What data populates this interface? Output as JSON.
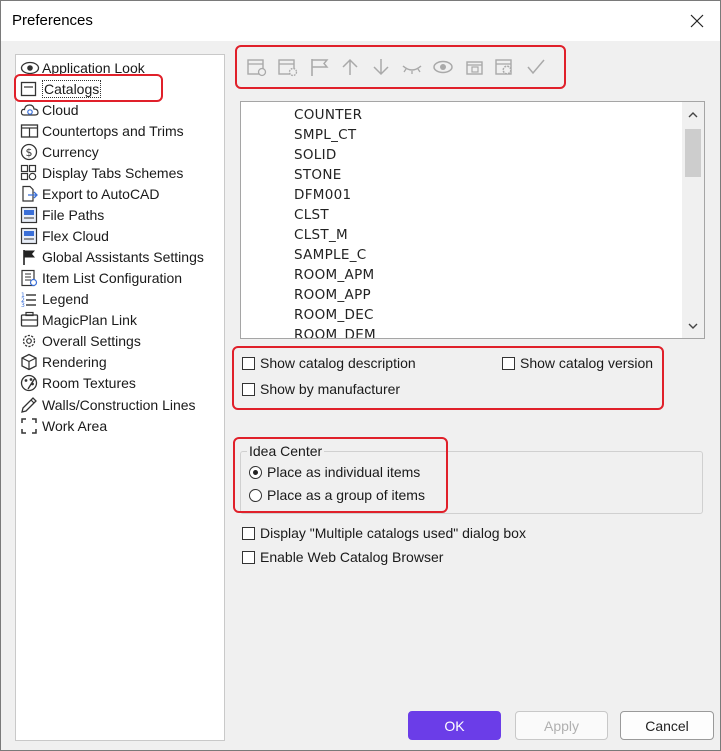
{
  "window": {
    "title": "Preferences"
  },
  "tree": {
    "items": [
      {
        "label": "Application Look",
        "icon": "eye-icon"
      },
      {
        "label": "Catalogs",
        "icon": "catalog-icon",
        "selected": true
      },
      {
        "label": "Cloud",
        "icon": "cloud-icon"
      },
      {
        "label": "Countertops and Trims",
        "icon": "countertop-icon"
      },
      {
        "label": "Currency",
        "icon": "dollar-icon"
      },
      {
        "label": "Display Tabs Schemes",
        "icon": "tabs-scheme-icon"
      },
      {
        "label": "Export to AutoCAD",
        "icon": "export-icon"
      },
      {
        "label": "File Paths",
        "icon": "file-paths-icon"
      },
      {
        "label": "Flex Cloud",
        "icon": "flex-cloud-icon"
      },
      {
        "label": "Global Assistants Settings",
        "icon": "flag-icon"
      },
      {
        "label": "Item List Configuration",
        "icon": "item-list-icon"
      },
      {
        "label": "Legend",
        "icon": "legend-icon"
      },
      {
        "label": "MagicPlan Link",
        "icon": "magicplan-icon"
      },
      {
        "label": "Overall Settings",
        "icon": "gear-icon"
      },
      {
        "label": "Rendering",
        "icon": "cube-icon"
      },
      {
        "label": "Room Textures",
        "icon": "textures-icon"
      },
      {
        "label": "Walls/Construction Lines",
        "icon": "pencil-icon"
      },
      {
        "label": "Work Area",
        "icon": "work-area-icon"
      }
    ]
  },
  "catalog_list": {
    "items": [
      "COUNTER",
      "SMPL_CT",
      "SOLID",
      "STONE",
      "DFM001",
      "CLST",
      "CLST_M",
      "SAMPLE_C",
      "ROOM_APM",
      "ROOM_APP",
      "ROOM_DEC",
      "ROOM_DEM"
    ]
  },
  "options": {
    "show_catalog_description": "Show catalog description",
    "show_catalog_version": "Show catalog version",
    "show_by_manufacturer": "Show by manufacturer",
    "display_multiple_catalogs": "Display \"Multiple catalogs used\" dialog box",
    "enable_web_catalog_browser": "Enable Web Catalog Browser"
  },
  "idea_center": {
    "legend": "Idea Center",
    "place_individual": "Place as individual items",
    "place_group": "Place as a group of items",
    "selected": "place_individual"
  },
  "buttons": {
    "ok": "OK",
    "apply": "Apply",
    "cancel": "Cancel"
  },
  "colors": {
    "accent": "#6b3de8",
    "annotation": "#e0202a",
    "icon_gray": "#a9a9a9"
  }
}
